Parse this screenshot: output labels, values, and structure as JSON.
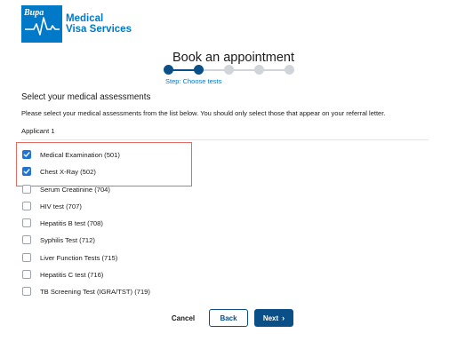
{
  "brand": {
    "logo_word": "Bupa",
    "line1": "Medical",
    "line2": "Visa Services",
    "color": "#0079c8"
  },
  "page": {
    "title": "Book an appointment"
  },
  "stepper": {
    "total_steps": 5,
    "current_step": 2,
    "current_label": "Step: Choose tests",
    "active_color": "#0a4f87",
    "inactive_color": "#d1d5da"
  },
  "assessments": {
    "heading": "Select your medical assessments",
    "instructions": "Please select your medical assessments from the list below. You should only select those that appear on your referral letter.",
    "applicant_label": "Applicant 1",
    "tests": [
      {
        "label": "Medical Examination (501)",
        "checked": true
      },
      {
        "label": "Chest X-Ray (502)",
        "checked": true
      },
      {
        "label": "Serum Creatinine (704)",
        "checked": false
      },
      {
        "label": "HIV test (707)",
        "checked": false
      },
      {
        "label": "Hepatitis B test (708)",
        "checked": false
      },
      {
        "label": "Syphilis Test (712)",
        "checked": false
      },
      {
        "label": "Liver Function Tests (715)",
        "checked": false
      },
      {
        "label": "Hepatitis C test (716)",
        "checked": false
      },
      {
        "label": "TB Screening Test (IGRA/TST) (719)",
        "checked": false
      }
    ],
    "highlight_color": "#e56a62"
  },
  "actions": {
    "cancel_label": "Cancel",
    "back_label": "Back",
    "next_label": "Next",
    "next_icon": "chevron-right-icon"
  }
}
